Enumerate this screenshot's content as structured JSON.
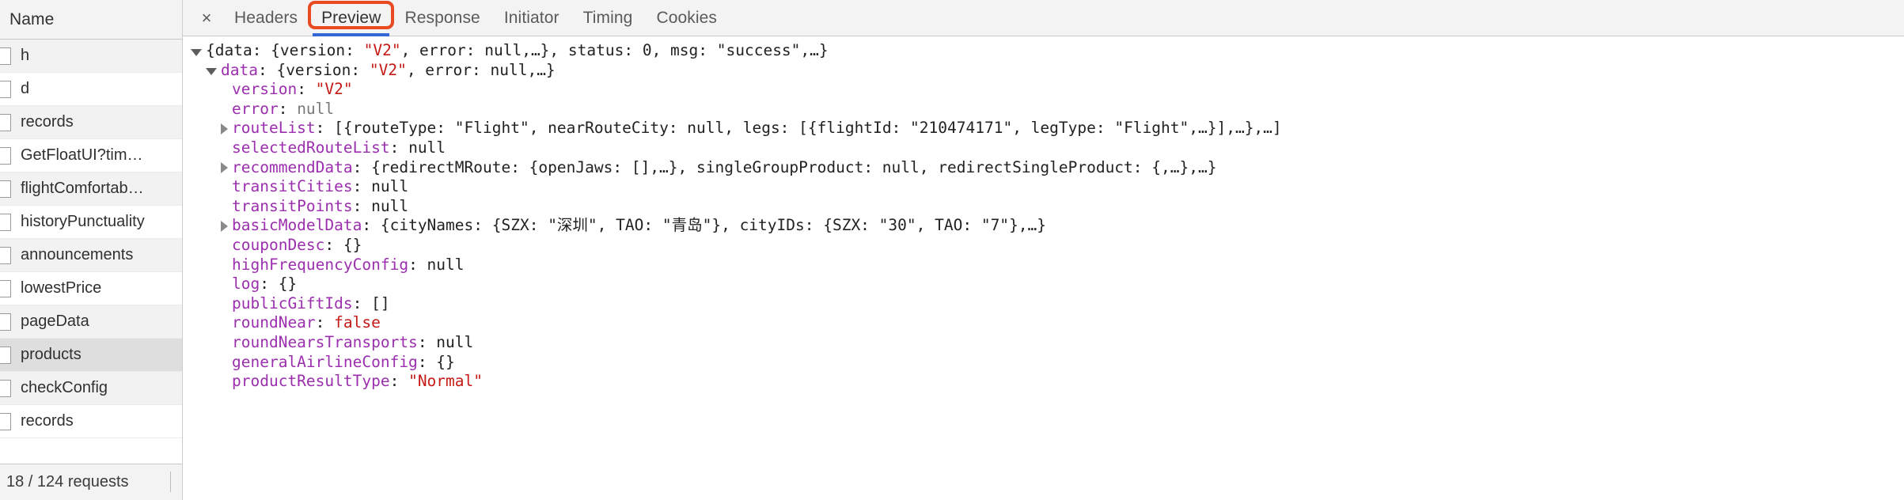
{
  "sidebar": {
    "header": "Name",
    "requests": [
      {
        "label": "h",
        "selected": false
      },
      {
        "label": "d",
        "selected": false
      },
      {
        "label": "records",
        "selected": false
      },
      {
        "label": "GetFloatUI?tim…",
        "selected": false
      },
      {
        "label": "flightComfortab…",
        "selected": false
      },
      {
        "label": "historyPunctuality",
        "selected": false
      },
      {
        "label": "announcements",
        "selected": false
      },
      {
        "label": "lowestPrice",
        "selected": false
      },
      {
        "label": "pageData",
        "selected": false
      },
      {
        "label": "products",
        "selected": true
      },
      {
        "label": "checkConfig",
        "selected": false
      },
      {
        "label": "records",
        "selected": false
      }
    ],
    "footer_status": "18 / 124 requests"
  },
  "details": {
    "close_label": "×",
    "tabs": [
      {
        "label": "Headers",
        "active": false
      },
      {
        "label": "Preview",
        "active": true
      },
      {
        "label": "Response",
        "active": false
      },
      {
        "label": "Initiator",
        "active": false
      },
      {
        "label": "Timing",
        "active": false
      },
      {
        "label": "Cookies",
        "active": false
      }
    ],
    "annotation_color": "#ea4a22",
    "active_tab_underline_color": "#3367d6"
  },
  "preview": {
    "lines": [
      {
        "indent": 0,
        "toggle": "down",
        "segments": [
          {
            "t": "{data: {version: ",
            "c": "punct"
          },
          {
            "t": "\"V2\"",
            "c": "s"
          },
          {
            "t": ", error: ",
            "c": "punct"
          },
          {
            "t": "null",
            "c": "punct"
          },
          {
            "t": ",…}, status: 0, msg: ",
            "c": "punct"
          },
          {
            "t": "\"success\"",
            "c": "punct"
          },
          {
            "t": ",…}",
            "c": "punct"
          }
        ]
      },
      {
        "indent": 1,
        "toggle": "down",
        "segments": [
          {
            "t": "data",
            "c": "k"
          },
          {
            "t": ": {version: ",
            "c": "punct"
          },
          {
            "t": "\"V2\"",
            "c": "s"
          },
          {
            "t": ", error: null,…}",
            "c": "punct"
          }
        ]
      },
      {
        "indent": 2,
        "toggle": "none",
        "segments": [
          {
            "t": "version",
            "c": "k"
          },
          {
            "t": ": ",
            "c": "punct"
          },
          {
            "t": "\"V2\"",
            "c": "s"
          }
        ]
      },
      {
        "indent": 2,
        "toggle": "none",
        "segments": [
          {
            "t": "error",
            "c": "k"
          },
          {
            "t": ": ",
            "c": "punct"
          },
          {
            "t": "null",
            "c": "null"
          }
        ]
      },
      {
        "indent": 2,
        "toggle": "right",
        "segments": [
          {
            "t": "routeList",
            "c": "k"
          },
          {
            "t": ": [{routeType: ",
            "c": "punct"
          },
          {
            "t": "\"Flight\"",
            "c": "punct"
          },
          {
            "t": ", nearRouteCity: null, legs: [{flightId: ",
            "c": "punct"
          },
          {
            "t": "\"210474171\"",
            "c": "punct"
          },
          {
            "t": ", legType: ",
            "c": "punct"
          },
          {
            "t": "\"Flight\"",
            "c": "punct"
          },
          {
            "t": ",…}],…},…]",
            "c": "punct"
          }
        ]
      },
      {
        "indent": 2,
        "toggle": "none",
        "segments": [
          {
            "t": "selectedRouteList",
            "c": "k"
          },
          {
            "t": ": null",
            "c": "punct"
          }
        ]
      },
      {
        "indent": 2,
        "toggle": "right",
        "segments": [
          {
            "t": "recommendData",
            "c": "k"
          },
          {
            "t": ": {redirectMRoute: {openJaws: [],…}, singleGroupProduct: null, redirectSingleProduct: {,…},…}",
            "c": "punct"
          }
        ]
      },
      {
        "indent": 2,
        "toggle": "none",
        "segments": [
          {
            "t": "transitCities",
            "c": "k"
          },
          {
            "t": ": null",
            "c": "punct"
          }
        ]
      },
      {
        "indent": 2,
        "toggle": "none",
        "segments": [
          {
            "t": "transitPoints",
            "c": "k"
          },
          {
            "t": ": null",
            "c": "punct"
          }
        ]
      },
      {
        "indent": 2,
        "toggle": "right",
        "segments": [
          {
            "t": "basicModelData",
            "c": "k"
          },
          {
            "t": ": {cityNames: {SZX: ",
            "c": "punct"
          },
          {
            "t": "\"深圳\"",
            "c": "punct"
          },
          {
            "t": ", TAO: ",
            "c": "punct"
          },
          {
            "t": "\"青岛\"",
            "c": "punct"
          },
          {
            "t": "}, cityIDs: {SZX: ",
            "c": "punct"
          },
          {
            "t": "\"30\"",
            "c": "punct"
          },
          {
            "t": ", TAO: ",
            "c": "punct"
          },
          {
            "t": "\"7\"",
            "c": "punct"
          },
          {
            "t": "},…}",
            "c": "punct"
          }
        ]
      },
      {
        "indent": 2,
        "toggle": "none",
        "segments": [
          {
            "t": "couponDesc",
            "c": "k"
          },
          {
            "t": ": {}",
            "c": "punct"
          }
        ]
      },
      {
        "indent": 2,
        "toggle": "none",
        "segments": [
          {
            "t": "highFrequencyConfig",
            "c": "k"
          },
          {
            "t": ": null",
            "c": "punct"
          }
        ]
      },
      {
        "indent": 2,
        "toggle": "none",
        "segments": [
          {
            "t": "log",
            "c": "k"
          },
          {
            "t": ": {}",
            "c": "punct"
          }
        ]
      },
      {
        "indent": 2,
        "toggle": "none",
        "segments": [
          {
            "t": "publicGiftIds",
            "c": "k"
          },
          {
            "t": ": []",
            "c": "punct"
          }
        ]
      },
      {
        "indent": 2,
        "toggle": "none",
        "segments": [
          {
            "t": "roundNear",
            "c": "k"
          },
          {
            "t": ": ",
            "c": "punct"
          },
          {
            "t": "false",
            "c": "s"
          }
        ]
      },
      {
        "indent": 2,
        "toggle": "none",
        "segments": [
          {
            "t": "roundNearsTransports",
            "c": "k"
          },
          {
            "t": ": null",
            "c": "punct"
          }
        ]
      },
      {
        "indent": 2,
        "toggle": "none",
        "segments": [
          {
            "t": "generalAirlineConfig",
            "c": "k"
          },
          {
            "t": ": {}",
            "c": "punct"
          }
        ]
      },
      {
        "indent": 2,
        "toggle": "none",
        "segments": [
          {
            "t": "productResultType",
            "c": "k"
          },
          {
            "t": ": ",
            "c": "punct"
          },
          {
            "t": "\"Normal\"",
            "c": "s"
          }
        ]
      }
    ]
  }
}
